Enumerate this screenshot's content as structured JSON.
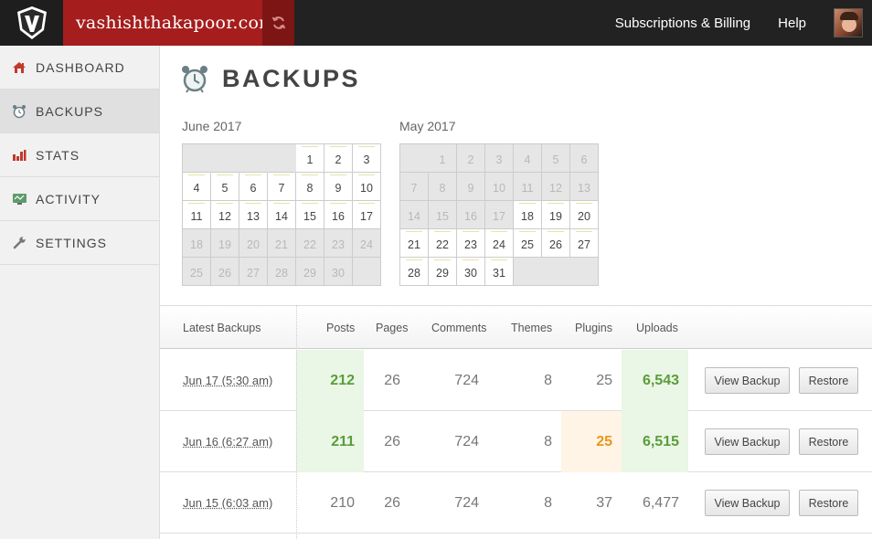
{
  "header": {
    "site_name": "vashishthakapoor.com",
    "nav": [
      "Subscriptions & Billing",
      "Help"
    ],
    "icons": {
      "logo": "vaultpress-v-logo",
      "sync": "sync-icon",
      "avatar": "user-avatar"
    },
    "colors": {
      "bar": "#222222",
      "site_block": "#a61d1d",
      "sync_block": "#7e1515"
    }
  },
  "sidebar": {
    "items": [
      {
        "label": "DASHBOARD",
        "icon": "home-icon",
        "active": false
      },
      {
        "label": "BACKUPS",
        "icon": "alarm-clock-icon",
        "active": true
      },
      {
        "label": "STATS",
        "icon": "bar-chart-icon",
        "active": false
      },
      {
        "label": "ACTIVITY",
        "icon": "monitor-icon",
        "active": false
      },
      {
        "label": "SETTINGS",
        "icon": "wrench-icon",
        "active": false
      }
    ]
  },
  "page": {
    "title": "BACKUPS",
    "icon": "alarm-clock-icon"
  },
  "calendars": [
    {
      "title": "June 2017",
      "cells": [
        {
          "t": "e"
        },
        {
          "t": "e"
        },
        {
          "t": "e"
        },
        {
          "t": "e"
        },
        {
          "t": "d",
          "v": "1"
        },
        {
          "t": "d",
          "v": "2"
        },
        {
          "t": "d",
          "v": "3"
        },
        {
          "t": "d",
          "v": "4"
        },
        {
          "t": "d",
          "v": "5"
        },
        {
          "t": "d",
          "v": "6"
        },
        {
          "t": "d",
          "v": "7"
        },
        {
          "t": "d",
          "v": "8"
        },
        {
          "t": "d",
          "v": "9"
        },
        {
          "t": "d",
          "v": "10"
        },
        {
          "t": "d",
          "v": "11"
        },
        {
          "t": "d",
          "v": "12"
        },
        {
          "t": "d",
          "v": "13"
        },
        {
          "t": "d",
          "v": "14"
        },
        {
          "t": "d",
          "v": "15"
        },
        {
          "t": "d",
          "v": "16"
        },
        {
          "t": "d",
          "v": "17"
        },
        {
          "t": "m",
          "v": "18"
        },
        {
          "t": "m",
          "v": "19"
        },
        {
          "t": "m",
          "v": "20"
        },
        {
          "t": "m",
          "v": "21"
        },
        {
          "t": "m",
          "v": "22"
        },
        {
          "t": "m",
          "v": "23"
        },
        {
          "t": "m",
          "v": "24"
        },
        {
          "t": "m",
          "v": "25"
        },
        {
          "t": "m",
          "v": "26"
        },
        {
          "t": "m",
          "v": "27"
        },
        {
          "t": "m",
          "v": "28"
        },
        {
          "t": "m",
          "v": "29"
        },
        {
          "t": "m",
          "v": "30"
        },
        {
          "t": "E"
        }
      ]
    },
    {
      "title": "May 2017",
      "cells": [
        {
          "t": "e"
        },
        {
          "t": "m",
          "v": "1"
        },
        {
          "t": "m",
          "v": "2"
        },
        {
          "t": "m",
          "v": "3"
        },
        {
          "t": "m",
          "v": "4"
        },
        {
          "t": "m",
          "v": "5"
        },
        {
          "t": "m",
          "v": "6"
        },
        {
          "t": "m",
          "v": "7"
        },
        {
          "t": "m",
          "v": "8"
        },
        {
          "t": "m",
          "v": "9"
        },
        {
          "t": "m",
          "v": "10"
        },
        {
          "t": "m",
          "v": "11"
        },
        {
          "t": "m",
          "v": "12"
        },
        {
          "t": "m",
          "v": "13"
        },
        {
          "t": "m",
          "v": "14"
        },
        {
          "t": "m",
          "v": "15"
        },
        {
          "t": "m",
          "v": "16"
        },
        {
          "t": "m",
          "v": "17"
        },
        {
          "t": "d",
          "v": "18"
        },
        {
          "t": "d",
          "v": "19"
        },
        {
          "t": "d",
          "v": "20"
        },
        {
          "t": "d",
          "v": "21"
        },
        {
          "t": "d",
          "v": "22"
        },
        {
          "t": "d",
          "v": "23"
        },
        {
          "t": "d",
          "v": "24"
        },
        {
          "t": "d",
          "v": "25"
        },
        {
          "t": "d",
          "v": "26"
        },
        {
          "t": "d",
          "v": "27"
        },
        {
          "t": "d",
          "v": "28"
        },
        {
          "t": "d",
          "v": "29"
        },
        {
          "t": "d",
          "v": "30"
        },
        {
          "t": "d",
          "v": "31"
        },
        {
          "t": "e"
        },
        {
          "t": "e"
        },
        {
          "t": "E"
        }
      ]
    }
  ],
  "table": {
    "headers": [
      "Latest Backups",
      "Posts",
      "Pages",
      "Comments",
      "Themes",
      "Plugins",
      "Uploads"
    ],
    "view_label": "View Backup",
    "restore_label": "Restore",
    "rows": [
      {
        "date": "Jun 17 (5:30 am)",
        "values": [
          "212",
          "26",
          "724",
          "8",
          "25",
          "6,543"
        ],
        "hl": [
          "green",
          "",
          "",
          "",
          "",
          "green"
        ]
      },
      {
        "date": "Jun 16 (6:27 am)",
        "values": [
          "211",
          "26",
          "724",
          "8",
          "25",
          "6,515"
        ],
        "hl": [
          "green",
          "",
          "",
          "",
          "orange",
          "green"
        ]
      },
      {
        "date": "Jun 15 (6:03 am)",
        "values": [
          "210",
          "26",
          "724",
          "8",
          "37",
          "6,477"
        ],
        "hl": [
          "",
          "",
          "",
          "",
          "",
          ""
        ]
      }
    ],
    "colors": {
      "green_bg": "#eaf6e6",
      "green_text": "#5a9d3a",
      "orange_bg": "#fff4e6",
      "orange_text": "#e8961e"
    }
  }
}
